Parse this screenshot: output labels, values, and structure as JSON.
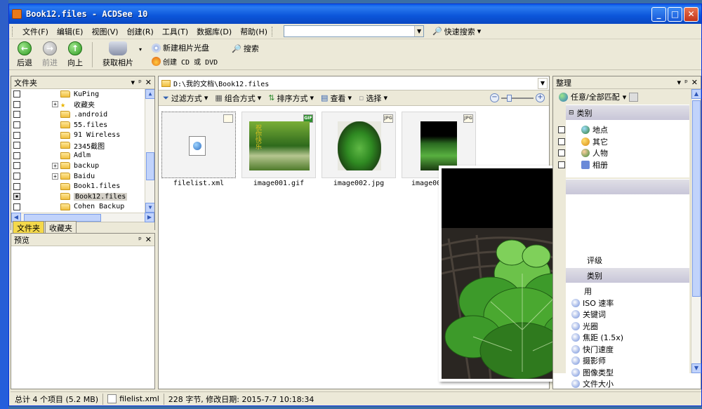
{
  "window": {
    "title": "Book12.files - ACDSee 10",
    "minimize": "_",
    "maximize": "□",
    "close": "✕"
  },
  "menu": [
    "文件(F)",
    "编辑(E)",
    "视图(V)",
    "创建(R)",
    "工具(T)",
    "数据库(D)",
    "帮助(H)"
  ],
  "search": {
    "value": "",
    "quick_search_label": "快速搜索"
  },
  "toolbar": {
    "back": "后退",
    "forward": "前进",
    "up": "向上",
    "acquire": "获取相片",
    "new_album": "新建相片光盘",
    "search": "搜索",
    "create_cd": "创建 CD 或 DVD"
  },
  "folders_pane": {
    "title": "文件夹",
    "items": [
      {
        "label": "KuPing",
        "checked": false,
        "expander": "",
        "kind": "folder"
      },
      {
        "label": "收藏夹",
        "checked": false,
        "expander": "+",
        "kind": "star"
      },
      {
        "label": ".android",
        "checked": false,
        "expander": "",
        "kind": "folder"
      },
      {
        "label": "55.files",
        "checked": false,
        "expander": "",
        "kind": "folder"
      },
      {
        "label": "91 Wireless",
        "checked": false,
        "expander": "",
        "kind": "folder"
      },
      {
        "label": "2345截图",
        "checked": false,
        "expander": "",
        "kind": "folder"
      },
      {
        "label": "Adlm",
        "checked": false,
        "expander": "",
        "kind": "folder"
      },
      {
        "label": "backup",
        "checked": false,
        "expander": "+",
        "kind": "folder"
      },
      {
        "label": "Baidu",
        "checked": false,
        "expander": "+",
        "kind": "folder"
      },
      {
        "label": "Book1.files",
        "checked": false,
        "expander": "",
        "kind": "folder"
      },
      {
        "label": "Book12.files",
        "checked": true,
        "expander": "",
        "kind": "folder",
        "selected": true
      },
      {
        "label": "Cohen Backup",
        "checked": false,
        "expander": "",
        "kind": "folder"
      }
    ],
    "tabs": [
      "文件夹",
      "收藏夹"
    ]
  },
  "preview_pane": {
    "title": "预览"
  },
  "browser": {
    "path": "D:\\我的文档\\Book12.files",
    "filters": {
      "filter": "过滤方式",
      "group": "组合方式",
      "sort": "排序方式",
      "view": "查看",
      "select": "选择"
    },
    "files": [
      {
        "name": "filelist.xml",
        "badge": "",
        "selected": true
      },
      {
        "name": "image001.gif",
        "badge": "GIF",
        "selected": false
      },
      {
        "name": "image002.jpg",
        "badge": "JPG",
        "selected": false
      },
      {
        "name": "image00",
        "badge": "JPG",
        "selected": false
      }
    ],
    "gif_caption": "祝你快乐"
  },
  "organize": {
    "title": "整理",
    "match_label": "任意/全部匹配",
    "section1": "类别",
    "categories": [
      "地点",
      "其它",
      "人物",
      "相册"
    ],
    "rating_label": "评级",
    "section2": "类别",
    "special_label": "用",
    "special": [
      "ISO 速率",
      "关键词",
      "光圈",
      "焦距 (1.5x)",
      "快门速度",
      "摄影师",
      "图像类型",
      "文件大小"
    ]
  },
  "status": {
    "total": "总计 4 个项目 (5.2 MB)",
    "file": "filelist.xml",
    "detail": "228 字节, 修改日期: 2015-7-7 10:18:34"
  },
  "colors": {
    "title_bar": "#0a5ee8",
    "window_bg": "#ece9d8",
    "leaf_green": "#3d9a2a"
  }
}
